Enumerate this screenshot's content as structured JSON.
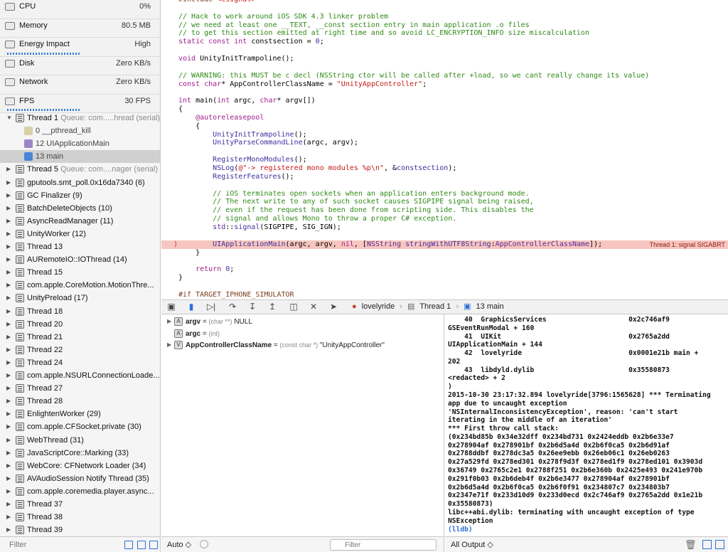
{
  "gauges": [
    {
      "name": "CPU",
      "value": "0%",
      "level": 0
    },
    {
      "name": "Memory",
      "value": "80.5 MB",
      "level": 0
    },
    {
      "name": "Energy Impact",
      "value": "High",
      "level": 0.47
    },
    {
      "name": "Disk",
      "value": "Zero KB/s",
      "level": 0
    },
    {
      "name": "Network",
      "value": "Zero KB/s",
      "level": 0
    },
    {
      "name": "FPS",
      "value": "30 FPS",
      "level": 0.48
    }
  ],
  "threads": [
    {
      "kind": "thread",
      "expanded": true,
      "label": "Thread 1",
      "queue": "Queue: com.....hread (serial)"
    },
    {
      "kind": "frame",
      "label": "0 __pthread_kill",
      "icon_color": "#d8cfa8",
      "selected": false
    },
    {
      "kind": "frame",
      "label": "12 UIApplicationMain",
      "icon_color": "#9a86c9",
      "selected": false
    },
    {
      "kind": "frame",
      "label": "13 main",
      "icon_color": "#4a86d8",
      "selected": true
    },
    {
      "kind": "thread",
      "label": "Thread 5",
      "queue": "Queue: com....nager (serial)"
    },
    {
      "kind": "thread",
      "label": "gputools.smt_poll.0x16da7340 (6)"
    },
    {
      "kind": "thread",
      "label": "GC Finalizer (9)"
    },
    {
      "kind": "thread",
      "label": "BatchDeleteObjects (10)"
    },
    {
      "kind": "thread",
      "label": "AsyncReadManager (11)"
    },
    {
      "kind": "thread",
      "label": "UnityWorker (12)"
    },
    {
      "kind": "thread",
      "label": "Thread 13"
    },
    {
      "kind": "thread",
      "label": "AURemoteIO::IOThread (14)"
    },
    {
      "kind": "thread",
      "label": "Thread 15"
    },
    {
      "kind": "thread",
      "label": "com.apple.CoreMotion.MotionThre..."
    },
    {
      "kind": "thread",
      "label": "UnityPreload (17)"
    },
    {
      "kind": "thread",
      "label": "Thread 18"
    },
    {
      "kind": "thread",
      "label": "Thread 20"
    },
    {
      "kind": "thread",
      "label": "Thread 21"
    },
    {
      "kind": "thread",
      "label": "Thread 22"
    },
    {
      "kind": "thread",
      "label": "Thread 24"
    },
    {
      "kind": "thread",
      "label": "com.apple.NSURLConnectionLoade..."
    },
    {
      "kind": "thread",
      "label": "Thread 27"
    },
    {
      "kind": "thread",
      "label": "Thread 28"
    },
    {
      "kind": "thread",
      "label": "EnlightenWorker (29)"
    },
    {
      "kind": "thread",
      "label": "com.apple.CFSocket.private (30)"
    },
    {
      "kind": "thread",
      "label": "WebThread (31)"
    },
    {
      "kind": "thread",
      "label": "JavaScriptCore::Marking (33)"
    },
    {
      "kind": "thread",
      "label": "WebCore: CFNetwork Loader (34)"
    },
    {
      "kind": "thread",
      "label": "AVAudioSession Notify Thread (35)"
    },
    {
      "kind": "thread",
      "label": "com.apple.coremedia.player.async..."
    },
    {
      "kind": "thread",
      "label": "Thread 37"
    },
    {
      "kind": "thread",
      "label": "Thread 38"
    },
    {
      "kind": "thread",
      "label": "Thread 39"
    }
  ],
  "sidebar_filter": {
    "placeholder": "Filter"
  },
  "code": [
    [
      [
        "#include ",
        "pp"
      ],
      [
        "<csignal>",
        "str"
      ]
    ],
    [],
    [
      [
        "// Hack to work around iOS SDK 4.3 linker problem",
        "com"
      ]
    ],
    [
      [
        "// we need at least one __TEXT, __const section entry in main application .o files",
        "com"
      ]
    ],
    [
      [
        "// to get this section emitted at right time and so avoid LC_ENCRYPTION_INFO size miscalculation",
        "com"
      ]
    ],
    [
      [
        "static const int",
        "kw"
      ],
      [
        " constsection = ",
        ""
      ],
      [
        "0",
        "fn"
      ],
      [
        ";",
        ""
      ]
    ],
    [],
    [
      [
        "void",
        "kw"
      ],
      [
        " UnityInitTrampoline();",
        ""
      ]
    ],
    [],
    [
      [
        "// WARNING: this MUST be c decl (NSString ctor will be called after +load, so we cant really change its value)",
        "com"
      ]
    ],
    [
      [
        "const char",
        "kw"
      ],
      [
        "* AppControllerClassName = ",
        ""
      ],
      [
        "\"UnityAppController\"",
        "str"
      ],
      [
        ";",
        ""
      ]
    ],
    [],
    [
      [
        "int",
        "kw"
      ],
      [
        " main(",
        ""
      ],
      [
        "int",
        "kw"
      ],
      [
        " argc, ",
        ""
      ],
      [
        "char",
        "kw"
      ],
      [
        "* argv[])",
        ""
      ]
    ],
    [
      [
        "{",
        ""
      ]
    ],
    [
      [
        "    ",
        ""
      ],
      [
        "@autoreleasepool",
        "kw"
      ]
    ],
    [
      [
        "    {",
        ""
      ]
    ],
    [
      [
        "        ",
        ""
      ],
      [
        "UnityInitTrampoline",
        "fn"
      ],
      [
        "();",
        ""
      ]
    ],
    [
      [
        "        ",
        ""
      ],
      [
        "UnityParseCommandLine",
        "fn"
      ],
      [
        "(argc, argv);",
        ""
      ]
    ],
    [],
    [
      [
        "        ",
        ""
      ],
      [
        "RegisterMonoModules",
        "fn"
      ],
      [
        "();",
        ""
      ]
    ],
    [
      [
        "        ",
        ""
      ],
      [
        "NSLog",
        "fn"
      ],
      [
        "(",
        ""
      ],
      [
        "@\"-> registered mono modules %p\\n\"",
        "str"
      ],
      [
        ", &",
        ""
      ],
      [
        "constsection",
        "fn"
      ],
      [
        ");",
        ""
      ]
    ],
    [
      [
        "        ",
        ""
      ],
      [
        "RegisterFeatures",
        "fn"
      ],
      [
        "();",
        ""
      ]
    ],
    [],
    [
      [
        "        // iOS terminates open sockets when an application enters background mode.",
        "com"
      ]
    ],
    [
      [
        "        // The next write to any of such socket causes SIGPIPE signal being raised,",
        "com"
      ]
    ],
    [
      [
        "        // even if the request has been done from scripting side. This disables the",
        "com"
      ]
    ],
    [
      [
        "        // signal and allows Mono to throw a proper C# exception.",
        "com"
      ]
    ],
    [
      [
        "        ",
        ""
      ],
      [
        "std",
        "ty"
      ],
      [
        "::",
        ""
      ],
      [
        "signal",
        "fn"
      ],
      [
        "(SIGPIPE, SIG_IGN);",
        ""
      ]
    ],
    [],
    [
      [
        "        ",
        ""
      ],
      [
        "UIApplicationMain",
        "fn"
      ],
      [
        "(argc, argv, ",
        ""
      ],
      [
        "nil",
        "kw"
      ],
      [
        ", [",
        ""
      ],
      [
        "NSString",
        "ty"
      ],
      [
        " ",
        ""
      ],
      [
        "stringWithUTF8String",
        "fn"
      ],
      [
        ":",
        ""
      ],
      [
        "AppControllerClassName",
        "ty"
      ],
      [
        "]);",
        ""
      ]
    ],
    [
      [
        "    }",
        ""
      ]
    ],
    [],
    [
      [
        "    ",
        ""
      ],
      [
        "return",
        "kw"
      ],
      [
        " ",
        ""
      ],
      [
        "0",
        "fn"
      ],
      [
        ";",
        ""
      ]
    ],
    [
      [
        "}",
        ""
      ]
    ],
    [],
    [
      [
        "#if TARGET_IPHONE_SIMULATOR",
        "pp"
      ]
    ]
  ],
  "error_line": 29,
  "error_badge": "Thread 1: signal SIGABRT",
  "breadcrumb": [
    "lovelyride",
    "Thread 1",
    "13 main"
  ],
  "variables": [
    {
      "icon": "A",
      "name": "argv",
      "type": "(char **)",
      "value": "NULL",
      "expandable": true
    },
    {
      "icon": "A",
      "name": "argc",
      "type": "(int)",
      "value": "",
      "expandable": false
    },
    {
      "icon": "V",
      "name": "AppControllerClassName",
      "type": "(const char *)",
      "value": "\"UnityAppController\"",
      "expandable": true
    }
  ],
  "vars_footer": {
    "scope": "Auto ◇",
    "filter_placeholder": "Filter"
  },
  "console": [
    "    40  GraphicsServices                    0x2c746af9",
    "GSEventRunModal + 160",
    "    41  UIKit                               0x2765a2dd",
    "UIApplicationMain + 144",
    "    42  lovelyride                          0x0001e21b main +",
    "202",
    "    43  libdyld.dylib                       0x35580873",
    "<redacted> + 2",
    ")",
    "2015-10-30 23:17:32.894 lovelyride[3796:1565628] *** Terminating",
    "app due to uncaught exception",
    "'NSInternalInconsistencyException', reason: 'can't start",
    "iterating in the middle of an iteration'",
    "*** First throw call stack:",
    "(0x234bd85b 0x34e32dff 0x234bd731 0x2424eddb 0x2b6e33e7",
    "0x278904af 0x278901bf 0x2b6d5a4d 0x2b6f0ca5 0x2b6d91af",
    "0x2788ddbf 0x278dc3a5 0x26ee9ebb 0x26eb06c1 0x26eb0263",
    "0x27a529fd 0x278ed301 0x278f9d3f 0x278ed1f9 0x278ed101 0x3903d",
    "0x36749 0x2765c2e1 0x2788f251 0x2b6e360b 0x2425e493 0x241e970b",
    "0x291f0b03 0x2b6deb4f 0x2b6e3477 0x278904af 0x278901bf",
    "0x2b6d5a4d 0x2b6f0ca5 0x2b6f0f91 0x234807c7 0x234803b7",
    "0x2347e71f 0x233d10d9 0x233d0ecd 0x2c746af9 0x2765a2dd 0x1e21b",
    "0x35580873)",
    "libc++abi.dylib: terminating with uncaught exception of type",
    "NSException"
  ],
  "console_prompt": "(lldb)",
  "console_footer": {
    "mode": "All Output ◇"
  }
}
